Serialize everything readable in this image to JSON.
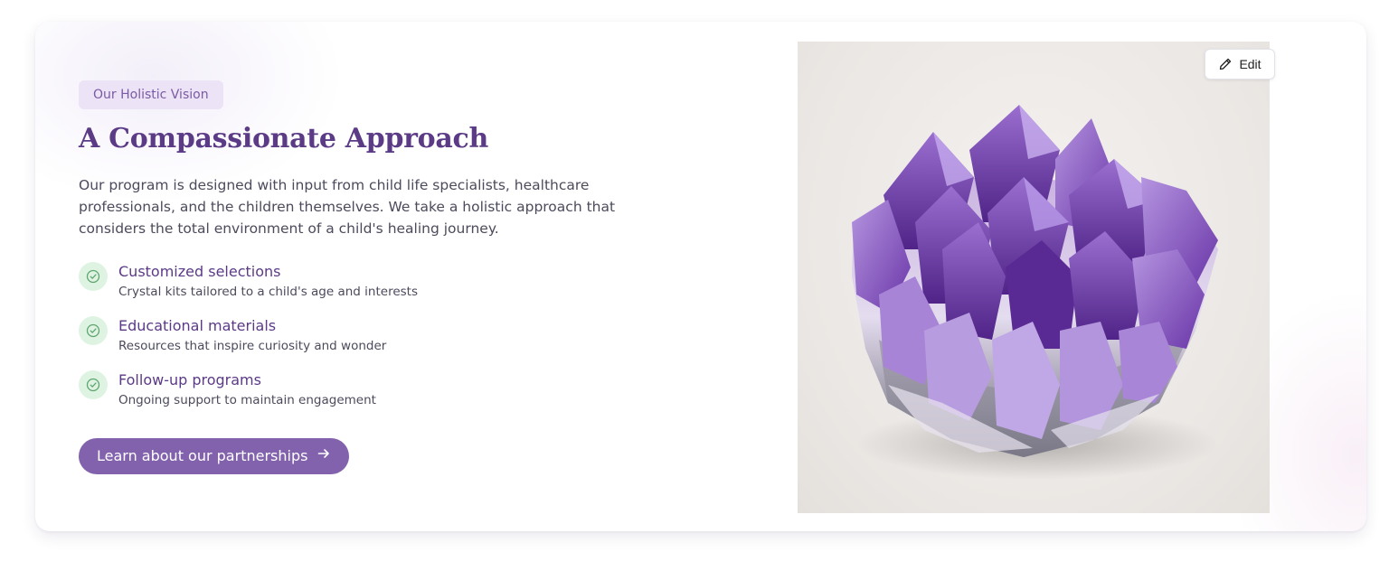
{
  "section": {
    "badge": "Our Holistic Vision",
    "title": "A Compassionate Approach",
    "description": "Our program is designed with input from child life specialists, healthcare professionals, and the children themselves. We take a holistic approach that considers the total environment of a child's healing journey.",
    "features": [
      {
        "title": "Customized selections",
        "description": "Crystal kits tailored to a child's age and interests",
        "icon": "check-circle-icon"
      },
      {
        "title": "Educational materials",
        "description": "Resources that inspire curiosity and wonder",
        "icon": "check-circle-icon"
      },
      {
        "title": "Follow-up programs",
        "description": "Ongoing support to maintain engagement",
        "icon": "check-circle-icon"
      }
    ],
    "cta": {
      "label": "Learn about our partnerships",
      "icon": "arrow-right-icon"
    }
  },
  "image": {
    "subject": "amethyst-crystal-cluster",
    "edit_label": "Edit",
    "edit_icon": "pencil-icon"
  },
  "colors": {
    "accent": "#8262ad",
    "heading": "#5b3a86",
    "badge_bg": "#ede3f7",
    "check_bg": "#dff3e3",
    "check_stroke": "#5fa56f"
  }
}
